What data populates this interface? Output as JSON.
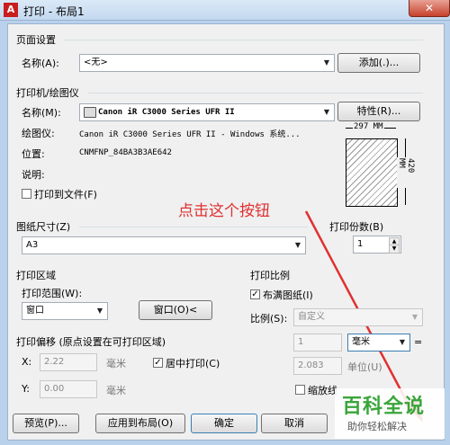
{
  "window": {
    "title": "打印 - 布局1",
    "app_icon": "autocad-icon",
    "close_icon": "close-icon"
  },
  "page_setup": {
    "section": "页面设置",
    "name_label": "名称(A):",
    "name_value": "<无>",
    "add_button": "添加(.)..."
  },
  "printer": {
    "section": "打印机/绘图仪",
    "name_label": "名称(M):",
    "name_value": "Canon iR C3000 Series UFR II",
    "properties_button": "特性(R)...",
    "plotter_label": "绘图仪:",
    "plotter_value": "Canon iR C3000 Series UFR II - Windows 系统...",
    "location_label": "位置:",
    "location_value": "CNMFNP_84BA3B3AE642",
    "description_label": "说明:",
    "print_to_file_label": "打印到文件(F)",
    "print_to_file_checked": false,
    "preview_width": "297 MM",
    "preview_height": "420 MM"
  },
  "annotation": "点击这个按钮",
  "paper_size": {
    "label": "图纸尺寸(Z)",
    "value": "A3"
  },
  "copies": {
    "label": "打印份数(B)",
    "value": "1"
  },
  "plot_area": {
    "section": "打印区域",
    "range_label": "打印范围(W):",
    "range_value": "窗口",
    "window_button": "窗口(O)<"
  },
  "plot_offset": {
    "section": "打印偏移 (原点设置在可打印区域)",
    "x_label": "X:",
    "x_value": "2.22",
    "x_unit": "毫米",
    "y_label": "Y:",
    "y_value": "0.00",
    "y_unit": "毫米",
    "center_label": "居中打印(C)",
    "center_checked": true
  },
  "plot_scale": {
    "section": "打印比例",
    "fit_label": "布满图纸(I)",
    "fit_checked": true,
    "scale_label": "比例(S):",
    "scale_value": "自定义",
    "val1": "1",
    "unit_value": "毫米",
    "eq": "=",
    "val2": "2.083",
    "unit_label": "单位(U)",
    "linewidth_label": "缩放线"
  },
  "buttons": {
    "preview": "预览(P)...",
    "apply": "应用到布局(O)",
    "ok": "确定",
    "cancel": "取消"
  },
  "watermark": {
    "title": "百科全说",
    "subtitle": "助你轻松解决"
  },
  "colors": {
    "accent_red": "#e03030",
    "watermark_green": "#3aa53a"
  }
}
